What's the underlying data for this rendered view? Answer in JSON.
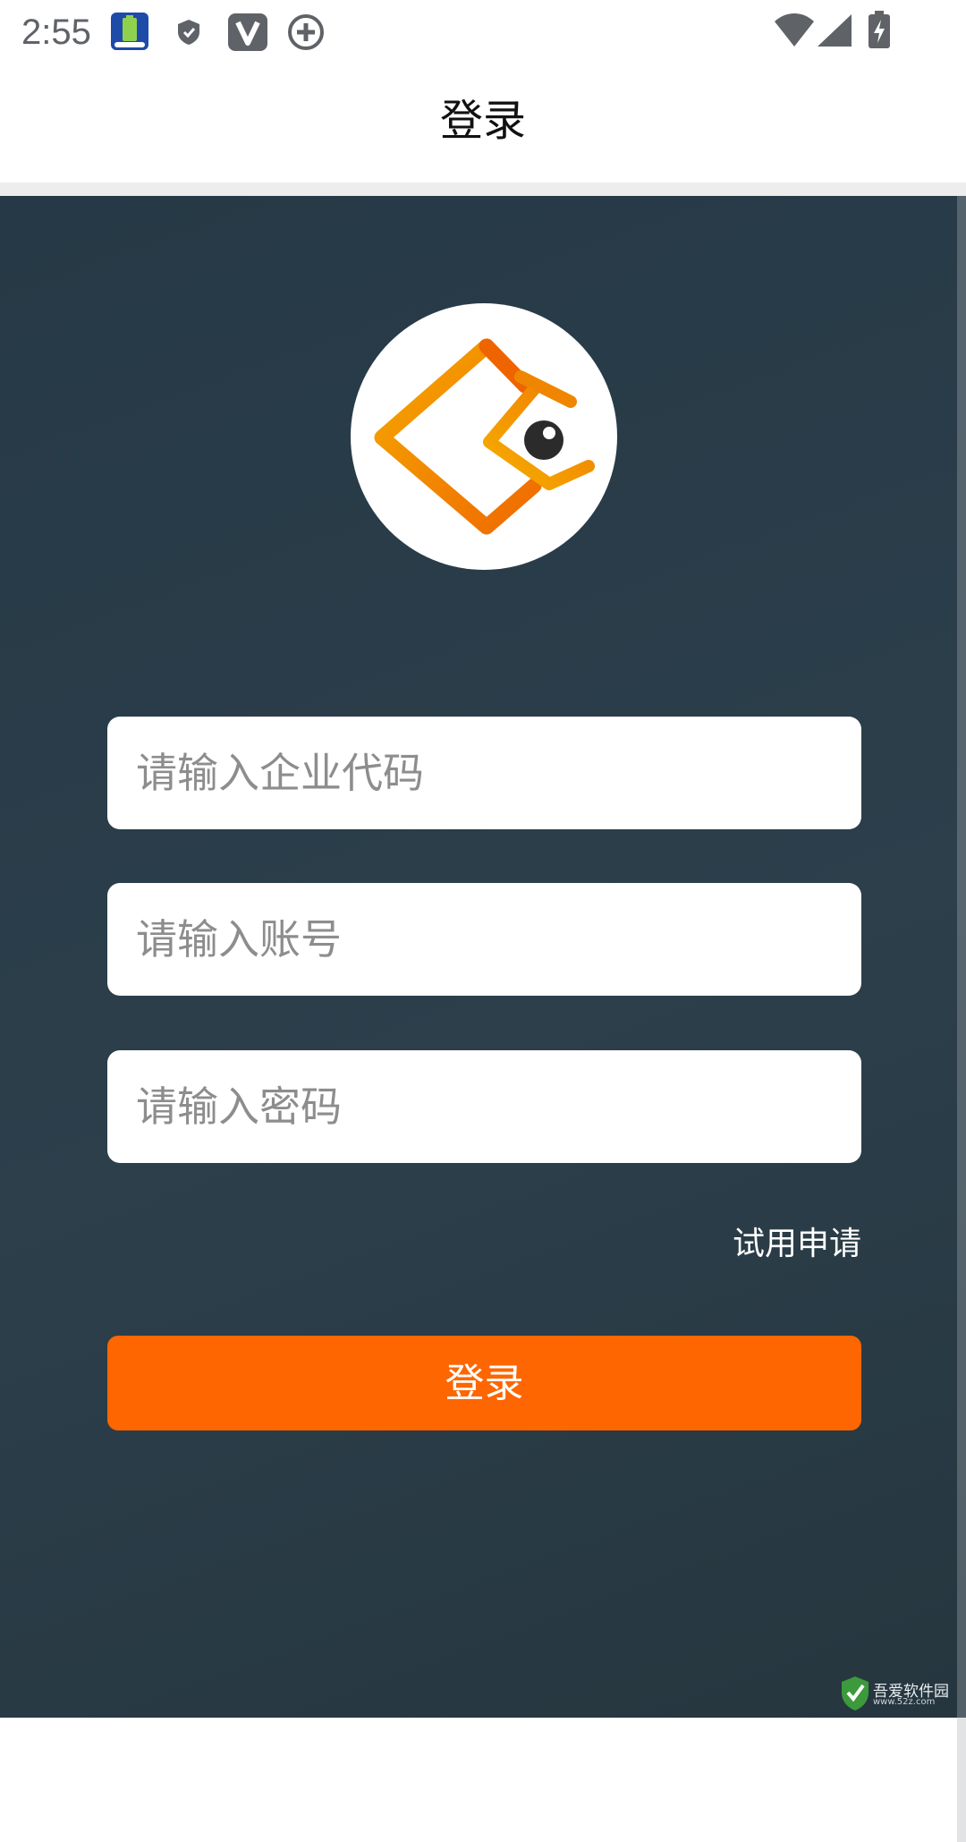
{
  "status_bar": {
    "time": "2:55",
    "left_icons": [
      "battery-app-icon",
      "shield-icon",
      "v-app-icon",
      "add-circle-icon"
    ],
    "right_icons": [
      "wifi-icon",
      "signal-icon",
      "battery-charging-icon"
    ]
  },
  "header": {
    "title": "登录"
  },
  "form": {
    "company_code_placeholder": "请输入企业代码",
    "account_placeholder": "请输入账号",
    "password_placeholder": "请输入密码",
    "trial_link": "试用申请",
    "login_button": "登录"
  },
  "watermark": {
    "text": "吾爱软件园",
    "subtext": "www.52z.com"
  },
  "colors": {
    "background": "#2a3c48",
    "accent": "#fd6600",
    "logo_orange": "#f28c00",
    "logo_yellow": "#f5a800"
  }
}
